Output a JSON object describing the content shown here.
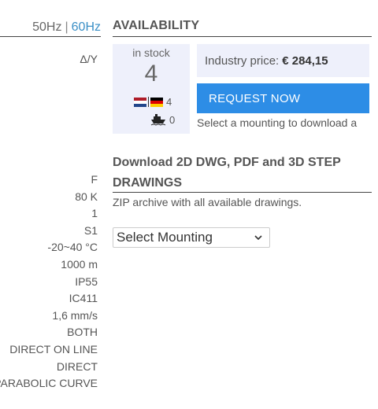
{
  "frequency": {
    "option_50": "50Hz",
    "separator": "|",
    "option_60": "60Hz",
    "active": "60Hz",
    "active_color": "#3a8fc6"
  },
  "left": {
    "connection": "Δ/Y",
    "specs": [
      "F",
      "80 K",
      "1",
      "S1",
      "-20~40 °C",
      "1000 m",
      "IP55",
      "IC411",
      "1,6 mm/s",
      "BOTH",
      "DIRECT ON LINE",
      "DIRECT",
      "PARABOLIC CURVE"
    ]
  },
  "availability": {
    "title": "AVAILABILITY",
    "stock_label": "in stock",
    "stock_count": "4",
    "warehouse_count": "4",
    "shipping_count": "0",
    "price_label": "Industry price:",
    "price_value": "€ 284,15",
    "request_button": "REQUEST NOW",
    "mount_note": "Select a mounting to download a",
    "accent_color": "#2d8de6",
    "icons": [
      "flag-netherlands-icon",
      "flag-germany-icon",
      "ship-icon"
    ]
  },
  "download": {
    "title": "Download 2D DWG, PDF and 3D STEP DRAWINGS",
    "subtitle": "ZIP archive with all available drawings.",
    "select_value": "Select Mounting"
  }
}
